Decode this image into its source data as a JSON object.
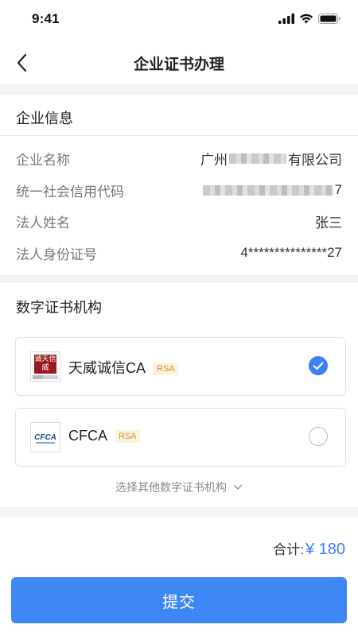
{
  "status_bar": {
    "time": "9:41"
  },
  "nav": {
    "title": "企业证书办理"
  },
  "company_info": {
    "title": "企业信息",
    "rows": [
      {
        "label": "企业名称",
        "value_prefix": "广州",
        "value_suffix": "有限公司"
      },
      {
        "label": "统一社会信用代码",
        "value_suffix": "7"
      },
      {
        "label": "法人姓名",
        "value": "张三"
      },
      {
        "label": "法人身份证号",
        "value": "4***************27"
      }
    ]
  },
  "ca_section": {
    "title": "数字证书机构",
    "options": [
      {
        "name": "天威诚信CA",
        "badge": "RSA",
        "selected": true,
        "logo_text": "诚天信威"
      },
      {
        "name": "CFCA",
        "badge": "RSA",
        "selected": false,
        "logo_text": "CFCA"
      }
    ],
    "more_label": "选择其他数字证书机构"
  },
  "footer": {
    "total_label": "合计:",
    "total_value": "¥ 180",
    "submit_label": "提交"
  },
  "colors": {
    "primary": "#3d87f5",
    "badge_bg": "#fdf3dd",
    "badge_text": "#c5933a"
  }
}
